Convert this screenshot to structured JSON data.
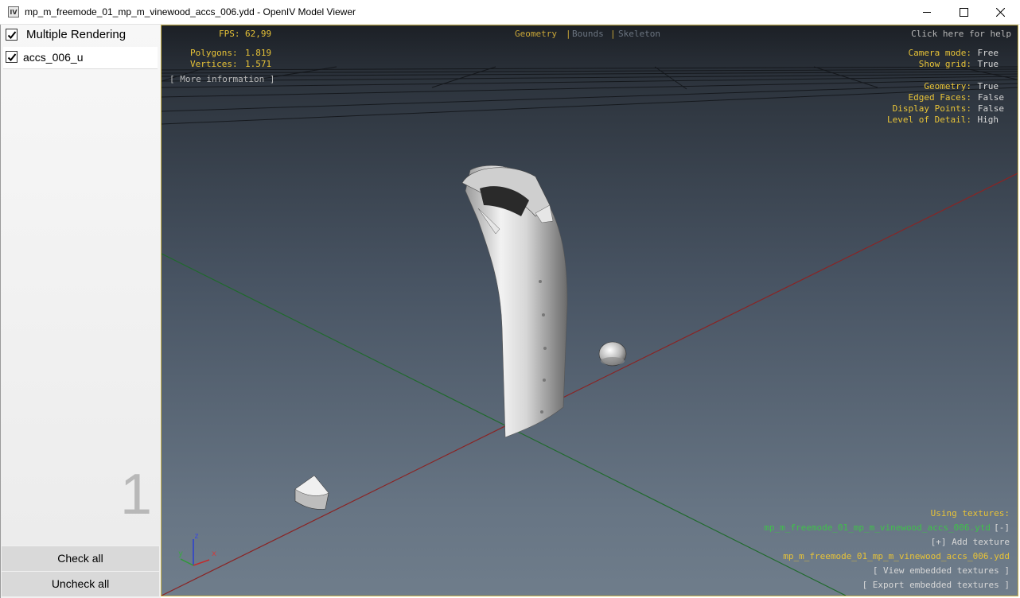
{
  "window": {
    "title": "mp_m_freemode_01_mp_m_vinewood_accs_006.ydd - OpenIV Model Viewer",
    "app_icon_text": "IV"
  },
  "left_panel": {
    "multiple_rendering_label": "Multiple Rendering",
    "multiple_rendering_checked": true,
    "items": [
      {
        "label": "accs_006_u",
        "checked": true
      }
    ],
    "count": "1",
    "check_all_label": "Check all",
    "uncheck_all_label": "Uncheck all"
  },
  "viewport": {
    "fps_label": "FPS:",
    "fps_value": "62,99",
    "polygons_label": "Polygons:",
    "polygons_value": "1.819",
    "vertices_label": "Vertices:",
    "vertices_value": "1.571",
    "more_info": "[ More information ]",
    "tabs": {
      "geometry": "Geometry",
      "sep": "|",
      "bounds": "Bounds",
      "skeleton": "Skeleton"
    },
    "help": "Click here for help",
    "camera_mode_label": "Camera mode:",
    "camera_mode_value": "Free",
    "show_grid_label": "Show grid:",
    "show_grid_value": "True",
    "geometry_label": "Geometry:",
    "geometry_value": "True",
    "edged_faces_label": "Edged Faces:",
    "edged_faces_value": "False",
    "display_points_label": "Display Points:",
    "display_points_value": "False",
    "lod_label": "Level of Detail:",
    "lod_value": "High",
    "using_textures": "Using textures:",
    "texture_ytd": "mp_m_freemode_01_mp_m_vinewood_accs_006.ytd",
    "remove_texture": "[-]",
    "add_texture": "[+] Add texture",
    "texture_ydd": "mp_m_freemode_01_mp_m_vinewood_accs_006.ydd",
    "view_embedded": "[ View embedded textures ]",
    "export_embedded": "[ Export embedded textures ]",
    "axis_x": "x",
    "axis_y": "y",
    "axis_z": "z"
  },
  "colors": {
    "accent_yellow": "#e8c337",
    "texture_green": "#3fc14a",
    "grid_red": "#9a2a2a",
    "grid_green": "#1f6a2c"
  }
}
